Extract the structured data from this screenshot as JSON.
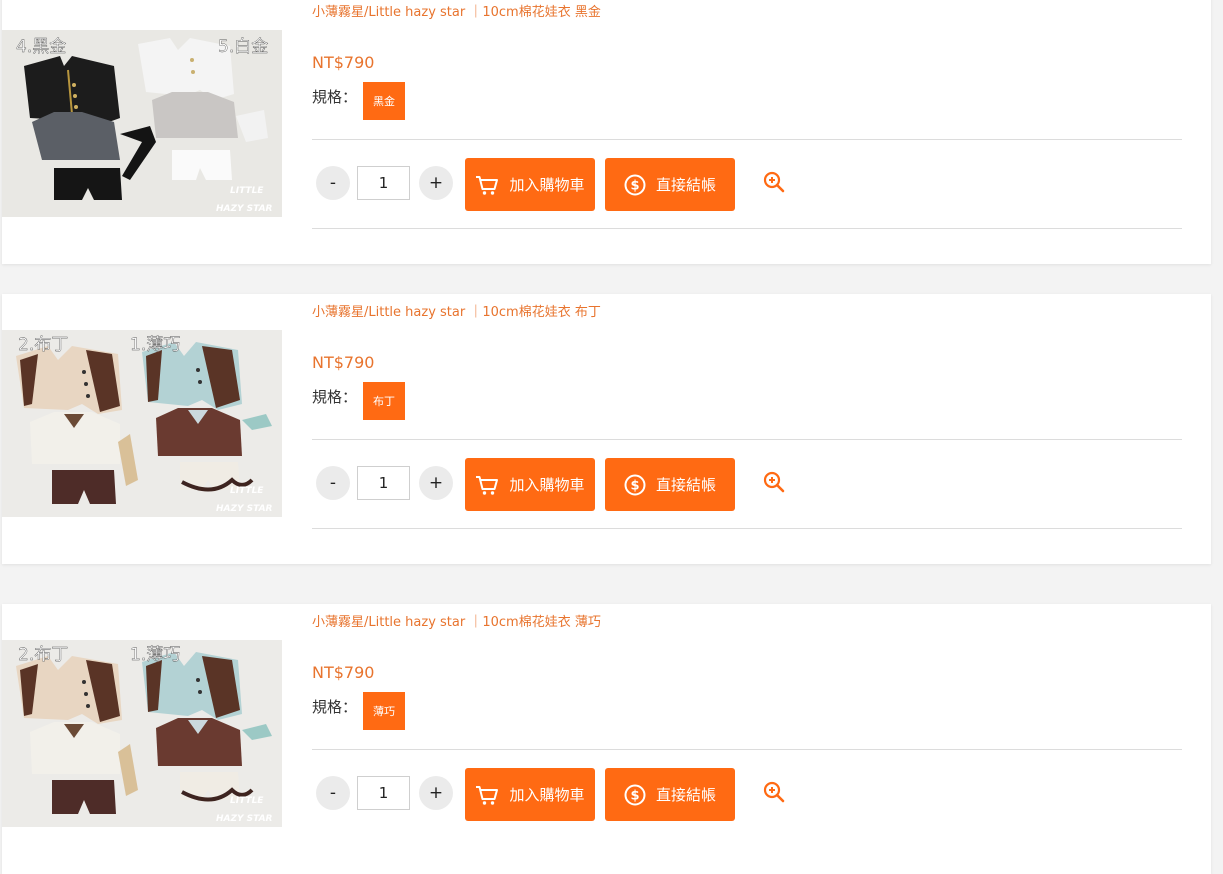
{
  "products": [
    {
      "name": "小薄霧星/Little hazy star ｜10cm棉花娃衣 黑金",
      "price": "NT$790",
      "spec_label": "規格：",
      "spec_value": "黑金",
      "quantity": "1",
      "minus_label": "-",
      "plus_label": "+",
      "add_to_cart_label": "加入購物車",
      "checkout_label": "直接結帳",
      "image_labels": [
        "4.黑金",
        "5.白金"
      ],
      "watermark": [
        "LITTLE",
        "HAZY STAR"
      ]
    },
    {
      "name": "小薄霧星/Little hazy star ｜10cm棉花娃衣 布丁",
      "price": "NT$790",
      "spec_label": "規格：",
      "spec_value": "布丁",
      "quantity": "1",
      "minus_label": "-",
      "plus_label": "+",
      "add_to_cart_label": "加入購物車",
      "checkout_label": "直接結帳",
      "image_labels": [
        "2.布丁",
        "1.薄巧"
      ],
      "watermark": [
        "LITTLE",
        "HAZY STAR"
      ]
    },
    {
      "name": "小薄霧星/Little hazy star ｜10cm棉花娃衣 薄巧",
      "price": "NT$790",
      "spec_label": "規格：",
      "spec_value": "薄巧",
      "quantity": "1",
      "minus_label": "-",
      "plus_label": "+",
      "add_to_cart_label": "加入購物車",
      "checkout_label": "直接結帳",
      "image_labels": [
        "2.布丁",
        "1.薄巧"
      ],
      "watermark": [
        "LITTLE",
        "HAZY STAR"
      ]
    }
  ],
  "icons": {
    "cart": "cart-icon",
    "checkout": "dollar-coin-icon",
    "zoom": "zoom-in-icon"
  },
  "colors": {
    "accent": "#ff6a13",
    "text_accent": "#e8742e",
    "background": "#f3f3f3"
  }
}
